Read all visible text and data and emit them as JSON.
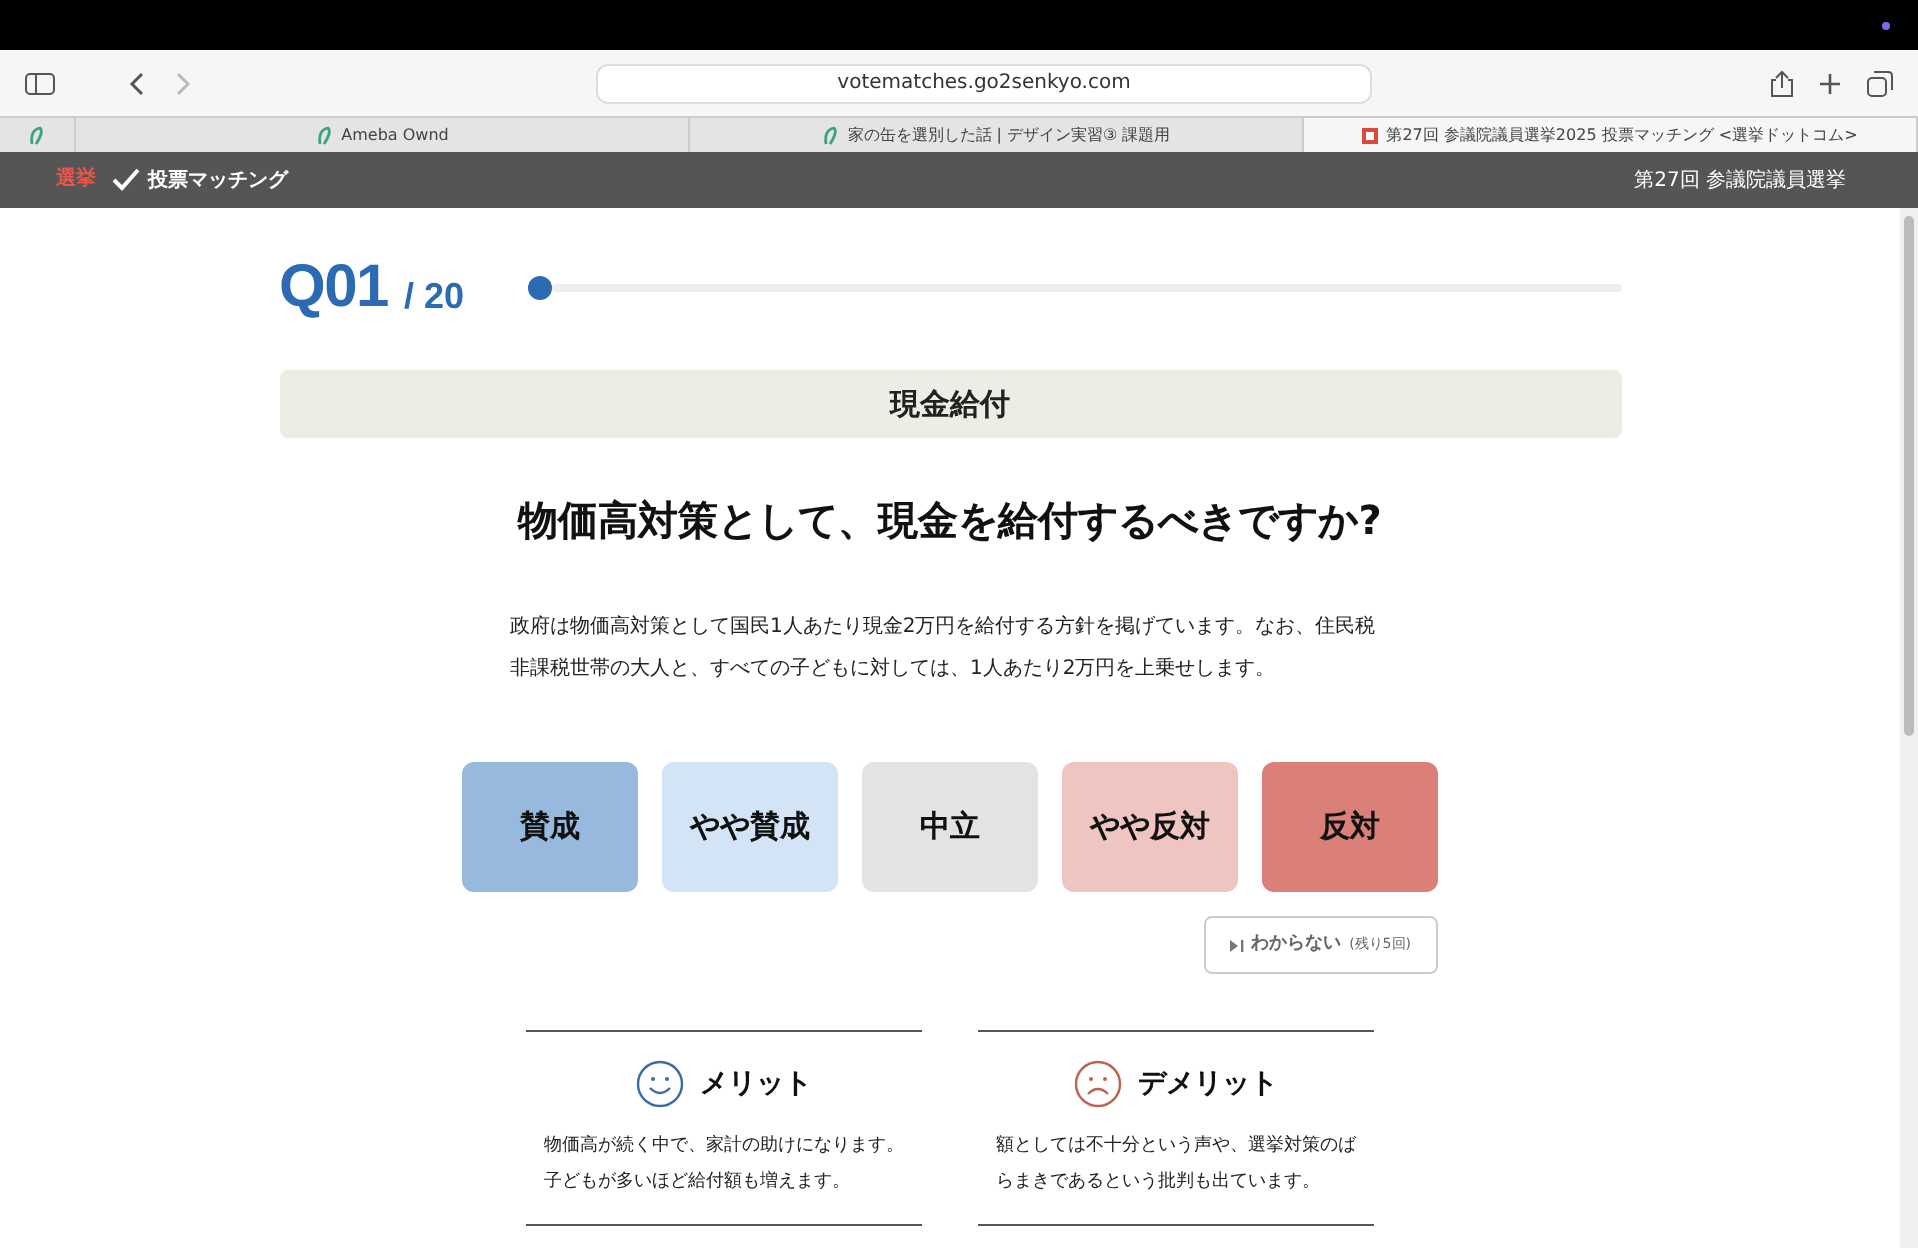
{
  "browser": {
    "url": "votematches.go2senkyo.com",
    "tabs": [
      {
        "title": "Ameba Ownd",
        "selected": false
      },
      {
        "title": "家の缶を選別した話 | デザイン実習③ 課題用",
        "selected": false
      },
      {
        "title": "第27回 参議院議員選挙2025 投票マッチング <選挙ドットコム>",
        "selected": true
      }
    ]
  },
  "header": {
    "logo_mark": "選挙",
    "logo_text": "投票マッチング",
    "election": "第27回 参議院議員選挙"
  },
  "progress": {
    "number": "Q01",
    "total": "/ 20",
    "level": 0
  },
  "category": "現金給付",
  "question": "物価高対策として、現金を給付するべきですか?",
  "description": "政府は物価高対策として国民1人あたり現金2万円を給付する方針を掲げています。なお、住民税非課税世帯の大人と、すべての子どもに対しては、1人あたり2万円を上乗せします。",
  "answers": [
    {
      "label": "賛成",
      "color": "#97b9de"
    },
    {
      "label": "やや賛成",
      "color": "#d3e4f6"
    },
    {
      "label": "中立",
      "color": "#e3e3e3"
    },
    {
      "label": "やや反対",
      "color": "#efc5c1"
    },
    {
      "label": "反対",
      "color": "#db8079"
    }
  ],
  "skip": {
    "label": "わからない",
    "remaining": "(残り5回)"
  },
  "points": [
    {
      "kind": "merit",
      "title": "メリット",
      "text": "物価高が続く中で、家計の助けになります。子どもが多いほど給付額も増えます。"
    },
    {
      "kind": "demerit",
      "title": "デメリット",
      "text": "額としては不十分という声や、選挙対策のばらまきであるという批判も出ています。"
    }
  ]
}
